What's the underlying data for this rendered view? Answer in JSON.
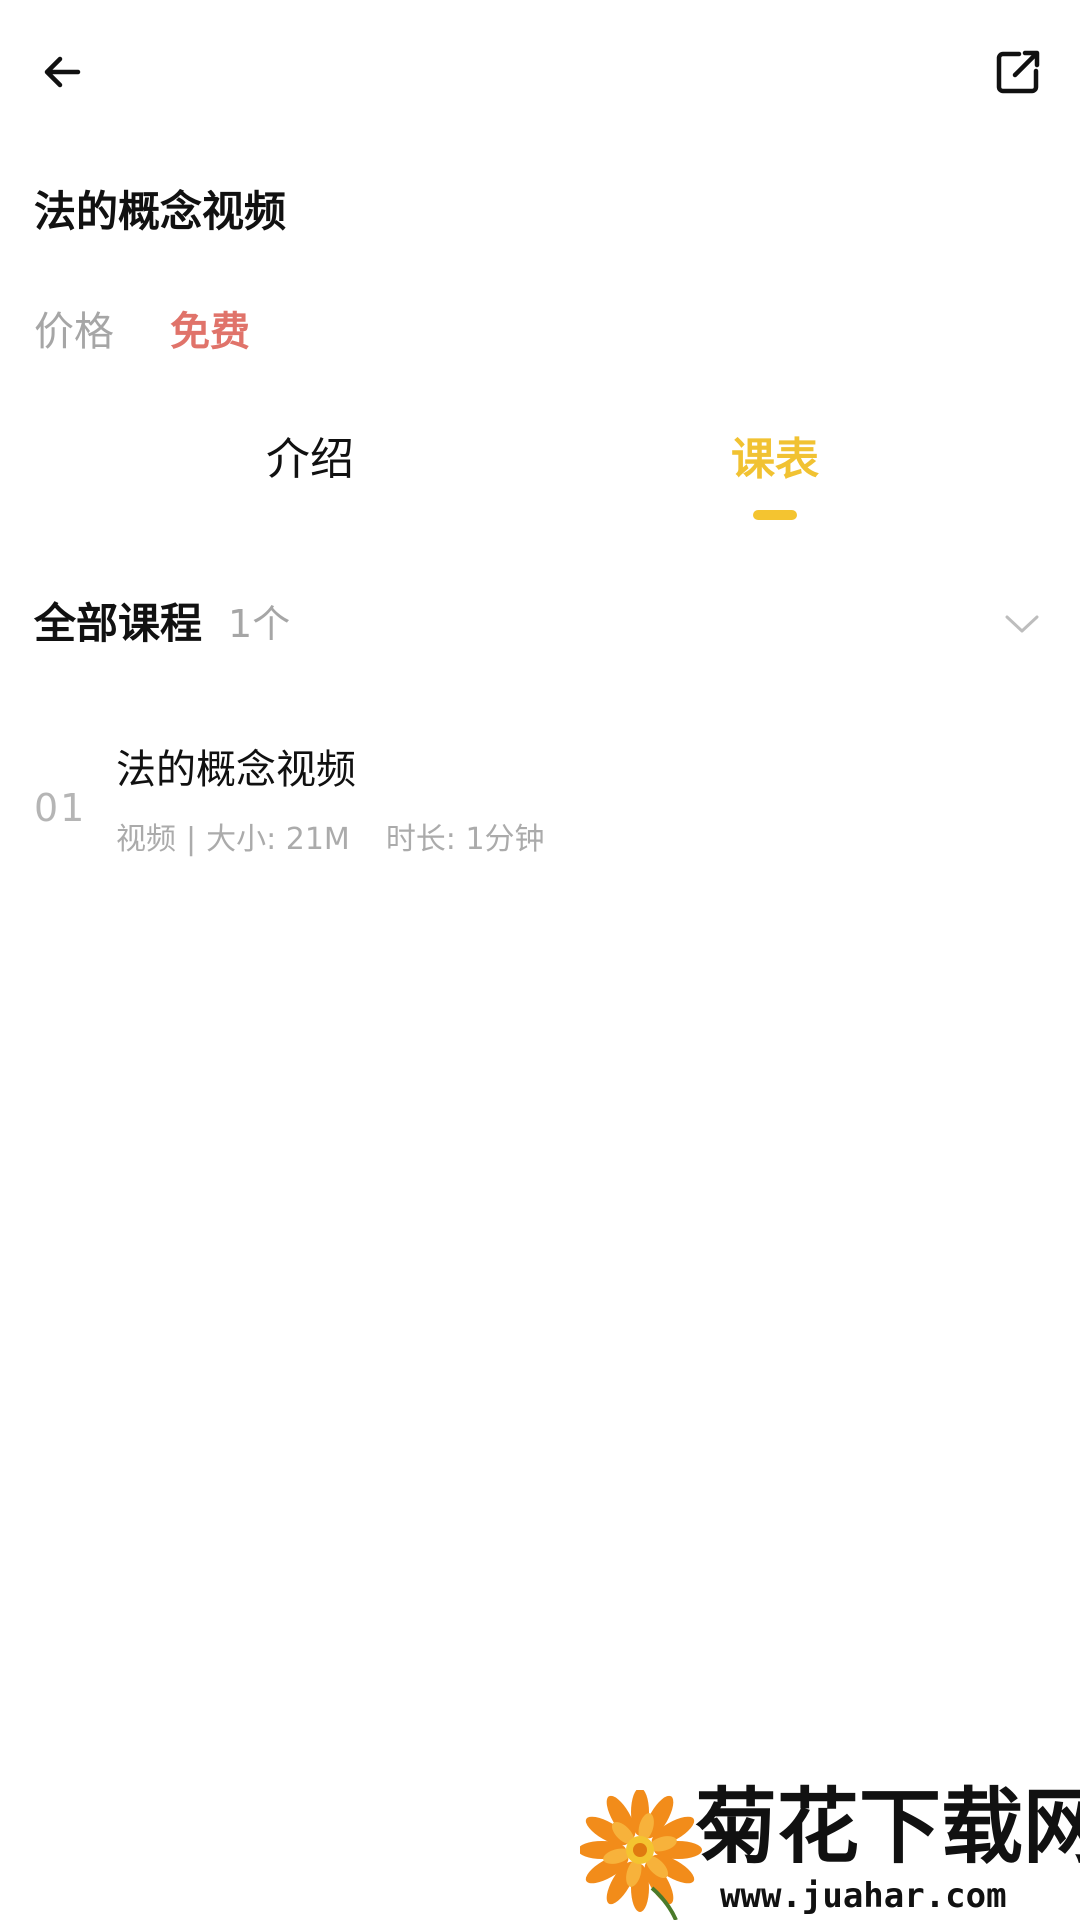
{
  "header": {
    "back_icon": "arrow-left-icon",
    "share_icon": "share-external-icon"
  },
  "course": {
    "title": "法的概念视频",
    "price_label": "价格",
    "price_value": "免费",
    "price_color": "#e0736a"
  },
  "tabs": [
    {
      "label": "介绍",
      "active": false
    },
    {
      "label": "课表",
      "active": true
    }
  ],
  "accent_color": "#f4c430",
  "section": {
    "title": "全部课程",
    "count": "1个",
    "toggle_icon": "chevron-down-icon"
  },
  "lessons": [
    {
      "index": "01",
      "title": "法的概念视频",
      "type": "视频",
      "separator": "|",
      "size": "大小: 21M",
      "duration": "时长: 1分钟"
    }
  ],
  "watermark": {
    "name": "菊花下载网",
    "url": "www.juahar.com"
  }
}
